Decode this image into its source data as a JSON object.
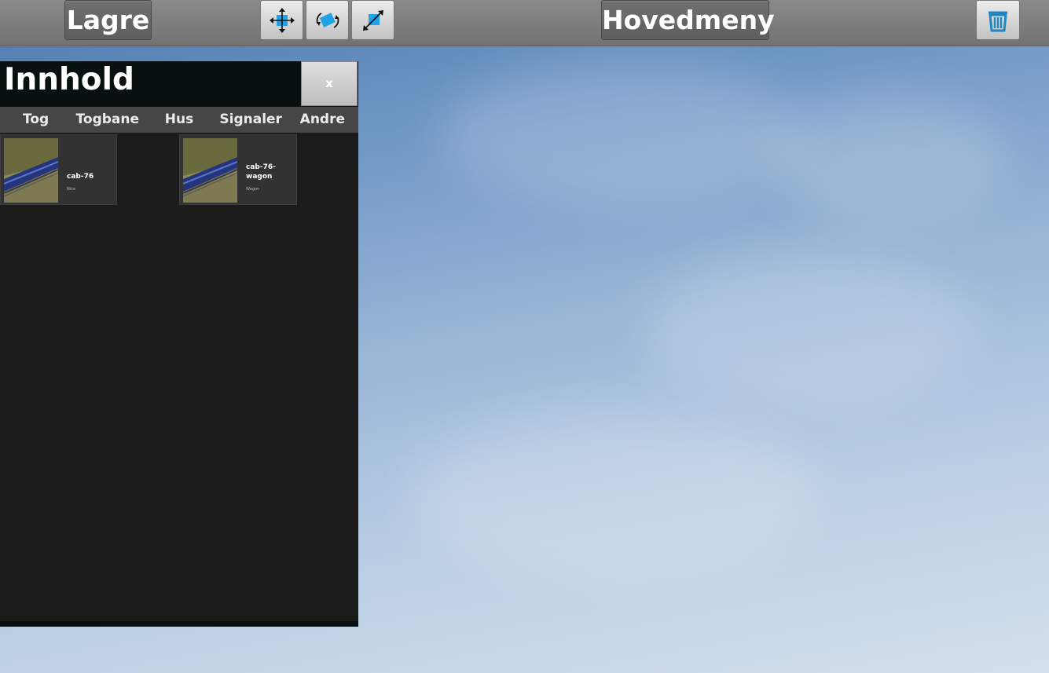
{
  "toolbar": {
    "save_label": "Lagre",
    "main_menu_label": "Hovedmeny",
    "tools": [
      {
        "name": "move",
        "icon": "move-arrows-icon"
      },
      {
        "name": "rotate",
        "icon": "rotate-icon"
      },
      {
        "name": "scale",
        "icon": "scale-icon"
      }
    ],
    "delete_icon": "trash-icon"
  },
  "panel": {
    "title": "Innhold",
    "close_label": "x",
    "tabs": [
      "Tog",
      "Togbane",
      "Hus",
      "Signaler",
      "Andre"
    ],
    "items": [
      {
        "name": "cab-76",
        "subtitle": "Nice"
      },
      {
        "name": "cab-76-wagon",
        "subtitle": "Wagon"
      }
    ]
  },
  "colors": {
    "accent_blue": "#1fa3e6",
    "panel_bg": "#1b1b1b",
    "header_bg": "#081010",
    "tab_bar_bg": "#464646"
  }
}
